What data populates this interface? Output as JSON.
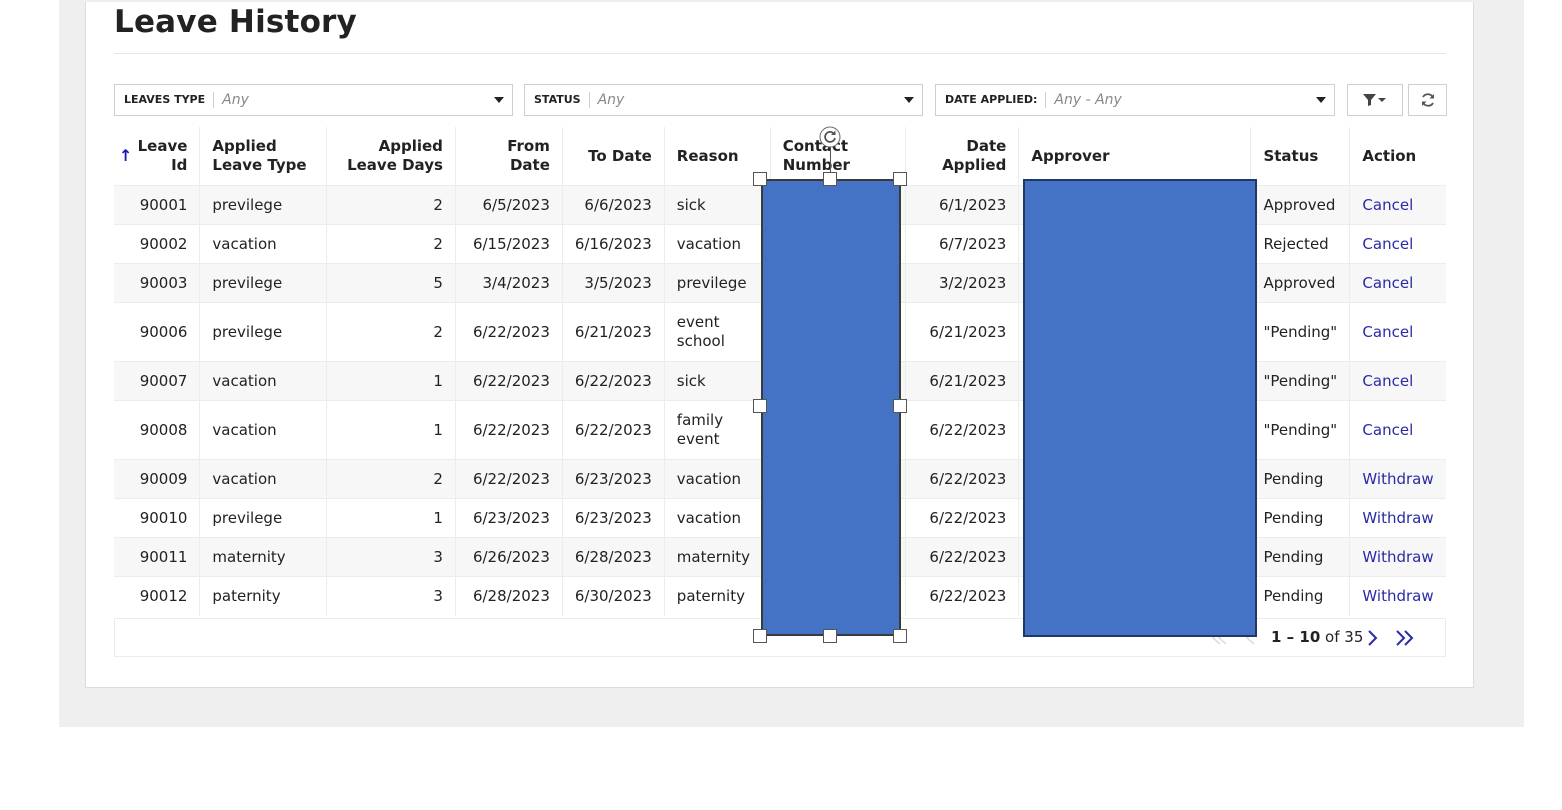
{
  "page": {
    "title": "Leave History"
  },
  "filters": {
    "leaves_type": {
      "label": "LEAVES TYPE",
      "value": "Any"
    },
    "status": {
      "label": "STATUS",
      "value": "Any"
    },
    "date_applied": {
      "label": "DATE APPLIED:",
      "value": "Any - Any"
    }
  },
  "table": {
    "sort_indicator": "↑",
    "columns": {
      "leave_id": [
        "Leave",
        "Id"
      ],
      "applied_leave_type": [
        "Applied",
        "Leave Type"
      ],
      "applied_leave_days": [
        "Applied",
        "Leave Days"
      ],
      "from_date": [
        "From",
        "Date"
      ],
      "to_date": "To Date",
      "reason": "Reason",
      "contact_number": [
        "Contact",
        "Number"
      ],
      "date_applied": [
        "Date",
        "Applied"
      ],
      "approver": "Approver",
      "status": "Status",
      "action": "Action"
    },
    "rows": [
      {
        "id": "90001",
        "type": "previlege",
        "days": "2",
        "from": "6/5/2023",
        "to": "6/6/2023",
        "reason": [
          "sick"
        ],
        "applied": "6/1/2023",
        "status": "Approved",
        "action": "Cancel"
      },
      {
        "id": "90002",
        "type": "vacation",
        "days": "2",
        "from": "6/15/2023",
        "to": "6/16/2023",
        "reason": [
          "vacation"
        ],
        "applied": "6/7/2023",
        "status": "Rejected",
        "action": "Cancel"
      },
      {
        "id": "90003",
        "type": "previlege",
        "days": "5",
        "from": "3/4/2023",
        "to": "3/5/2023",
        "reason": [
          "previlege"
        ],
        "applied": "3/2/2023",
        "status": "Approved",
        "action": "Cancel"
      },
      {
        "id": "90006",
        "type": "previlege",
        "days": "2",
        "from": "6/22/2023",
        "to": "6/21/2023",
        "reason": [
          "event",
          "school"
        ],
        "applied": "6/21/2023",
        "status": "\"Pending\"",
        "action": "Cancel"
      },
      {
        "id": "90007",
        "type": "vacation",
        "days": "1",
        "from": "6/22/2023",
        "to": "6/22/2023",
        "reason": [
          "sick"
        ],
        "applied": "6/21/2023",
        "status": "\"Pending\"",
        "action": "Cancel"
      },
      {
        "id": "90008",
        "type": "vacation",
        "days": "1",
        "from": "6/22/2023",
        "to": "6/22/2023",
        "reason": [
          "family",
          "event"
        ],
        "applied": "6/22/2023",
        "status": "\"Pending\"",
        "action": "Cancel"
      },
      {
        "id": "90009",
        "type": "vacation",
        "days": "2",
        "from": "6/22/2023",
        "to": "6/23/2023",
        "reason": [
          "vacation"
        ],
        "applied": "6/22/2023",
        "status": "Pending",
        "action": "Withdraw"
      },
      {
        "id": "90010",
        "type": "previlege",
        "days": "1",
        "from": "6/23/2023",
        "to": "6/23/2023",
        "reason": [
          "vacation"
        ],
        "applied": "6/22/2023",
        "status": "Pending",
        "action": "Withdraw"
      },
      {
        "id": "90011",
        "type": "maternity",
        "days": "3",
        "from": "6/26/2023",
        "to": "6/28/2023",
        "reason": [
          "maternity"
        ],
        "applied": "6/22/2023",
        "status": "Pending",
        "action": "Withdraw"
      },
      {
        "id": "90012",
        "type": "paternity",
        "days": "3",
        "from": "6/28/2023",
        "to": "6/30/2023",
        "reason": [
          "paternity"
        ],
        "applied": "6/22/2023",
        "status": "Pending",
        "action": "Withdraw"
      }
    ]
  },
  "pagination": {
    "range": "1 – 10",
    "of_label": "of",
    "total": "35"
  },
  "colors": {
    "accent": "#2a2aa5",
    "overlay_fill": "#4472c4",
    "overlay_border": "#1f3864"
  },
  "icons": [
    "filter-icon",
    "refresh-icon",
    "sort-up-icon",
    "chevron-right-icon",
    "double-chevron-right-icon",
    "rotate-handle-icon"
  ]
}
